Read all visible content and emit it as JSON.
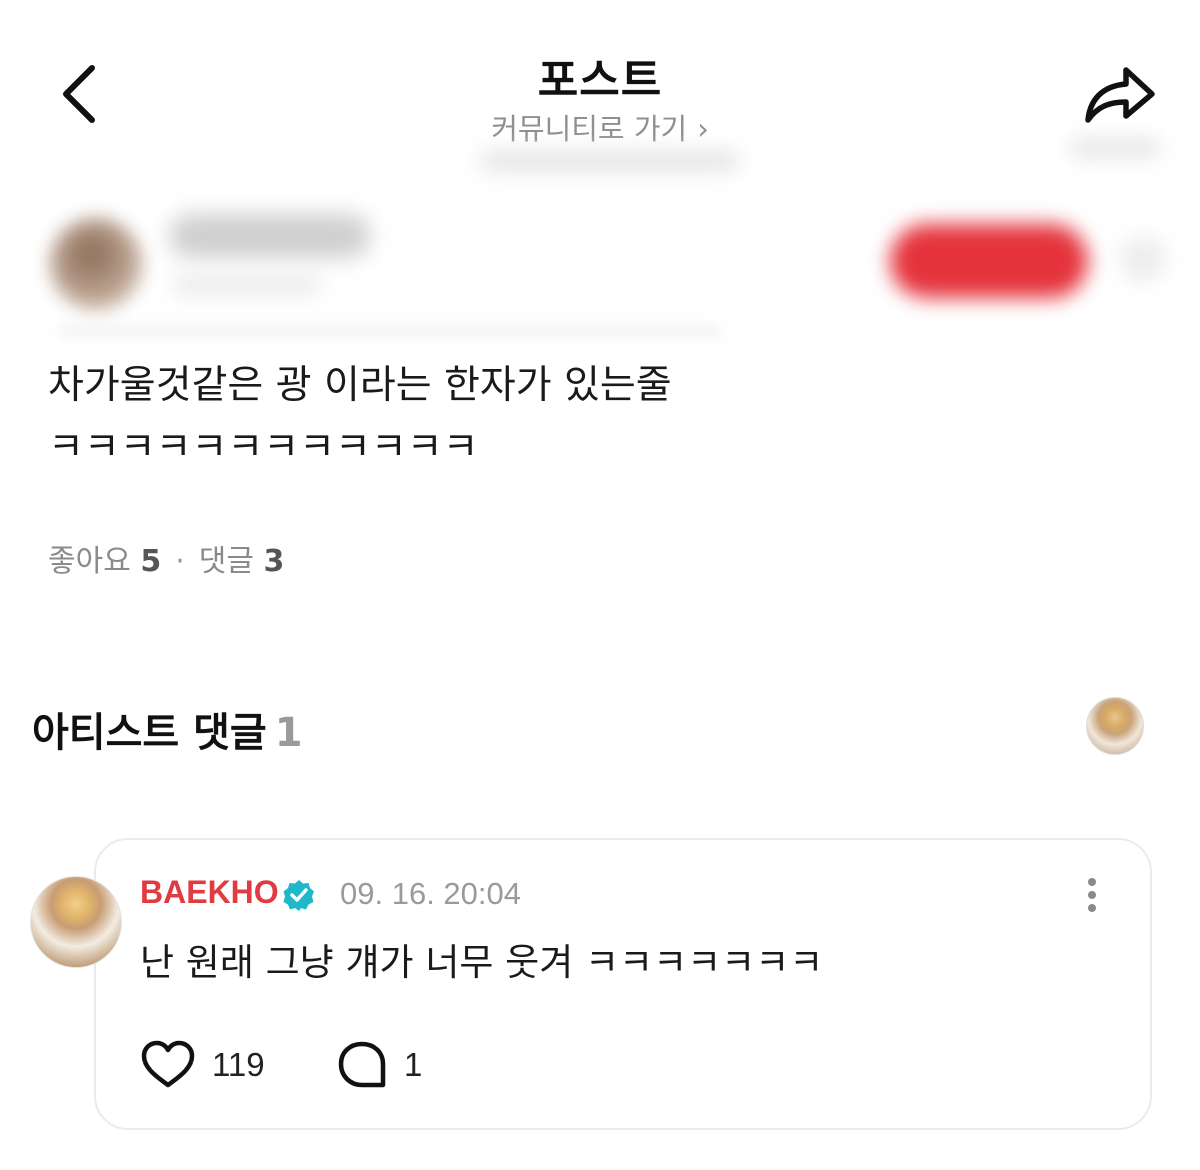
{
  "header": {
    "title": "포스트",
    "community_link": "커뮤니티로 가기",
    "community_chevron": "›"
  },
  "post": {
    "text_line1": "차가울것같은 광 이라는 한자가 있는줄",
    "text_line2": "ㅋㅋㅋㅋㅋㅋㅋㅋㅋㅋㅋㅋ",
    "likes_label": "좋아요",
    "likes_count": "5",
    "separator": "·",
    "comments_label": "댓글",
    "comments_count": "3"
  },
  "artist_comments": {
    "title": "아티스트 댓글",
    "count": "1",
    "comment": {
      "author": "BAEKHO",
      "verified": true,
      "timestamp": "09. 16. 20:04",
      "text": "난 원래 그냥 걔가 너무 웃겨 ㅋㅋㅋㅋㅋㅋㅋ",
      "like_count": "119",
      "reply_count": "1"
    }
  },
  "colors": {
    "accent_red": "#e23a41",
    "verified_teal": "#1fb8c8",
    "muted_text": "#8f8f8f"
  },
  "icons": {
    "back": "chevron-left-icon",
    "share": "share-arrow-icon",
    "verified": "verified-badge-icon",
    "more": "kebab-menu-icon",
    "like": "heart-outline-icon",
    "reply": "speech-bubble-icon"
  }
}
